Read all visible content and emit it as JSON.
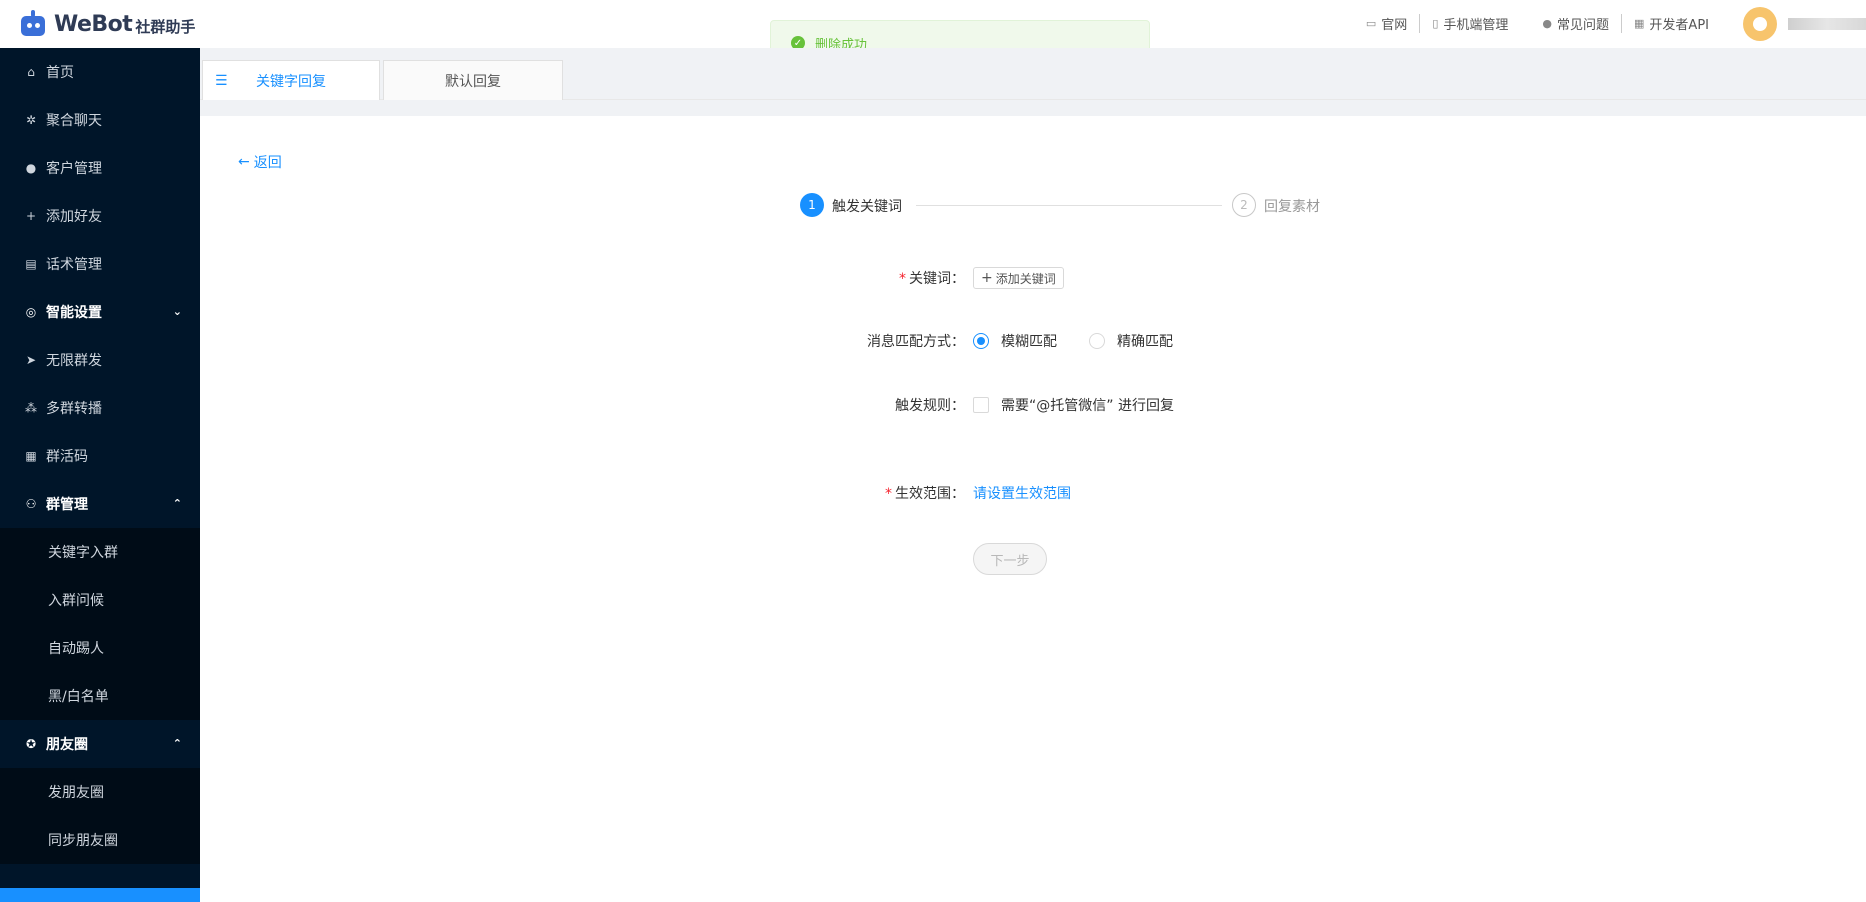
{
  "header": {
    "brand": "WeBot",
    "brand_sub": "社群助手",
    "links": [
      {
        "icon": "monitor-icon",
        "label": "官网"
      },
      {
        "icon": "phone-icon",
        "label": "手机端管理"
      },
      {
        "icon": "question-icon",
        "label": "常见问题"
      },
      {
        "icon": "api-icon",
        "label": "开发者API"
      }
    ]
  },
  "toast": {
    "message": "删除成功"
  },
  "sidebar": {
    "items": [
      {
        "label": "首页",
        "icon": "home-icon"
      },
      {
        "label": "聚合聊天",
        "icon": "gear-icon"
      },
      {
        "label": "客户管理",
        "icon": "user-icon"
      },
      {
        "label": "添加好友",
        "icon": "add-friend-icon"
      },
      {
        "label": "话术管理",
        "icon": "script-icon"
      },
      {
        "label": "智能设置",
        "icon": "smart-icon"
      },
      {
        "label": "无限群发",
        "icon": "send-icon"
      },
      {
        "label": "多群转播",
        "icon": "broadcast-icon"
      },
      {
        "label": "群活码",
        "icon": "qrcode-icon"
      },
      {
        "label": "群管理",
        "icon": "group-icon"
      },
      {
        "label": "朋友圈",
        "icon": "moments-icon"
      }
    ],
    "group_sub": [
      "关键字入群",
      "入群问候",
      "自动踢人",
      "黑/白名单"
    ],
    "moments_sub": [
      "发朋友圈",
      "同步朋友圈"
    ]
  },
  "tabs": [
    {
      "label": "关键字回复"
    },
    {
      "label": "默认回复"
    }
  ],
  "main": {
    "back_label": "返回",
    "steps": [
      {
        "num": "1",
        "label": "触发关键词"
      },
      {
        "num": "2",
        "label": "回复素材"
      }
    ],
    "form": {
      "keyword_label": "关键词",
      "add_keyword_button": "添加关键词",
      "match_label": "消息匹配方式",
      "match_options": [
        "模糊匹配",
        "精确匹配"
      ],
      "match_selected": "模糊匹配",
      "rule_label": "触发规则",
      "rule_text": "需要“@托管微信” 进行回复",
      "scope_label": "生效范围",
      "scope_link": "请设置生效范围",
      "next_button": "下一步"
    }
  },
  "colors": {
    "primary": "#1890ff",
    "sidebar_bg": "#001529",
    "success": "#67c23a",
    "required": "#f5222d"
  }
}
